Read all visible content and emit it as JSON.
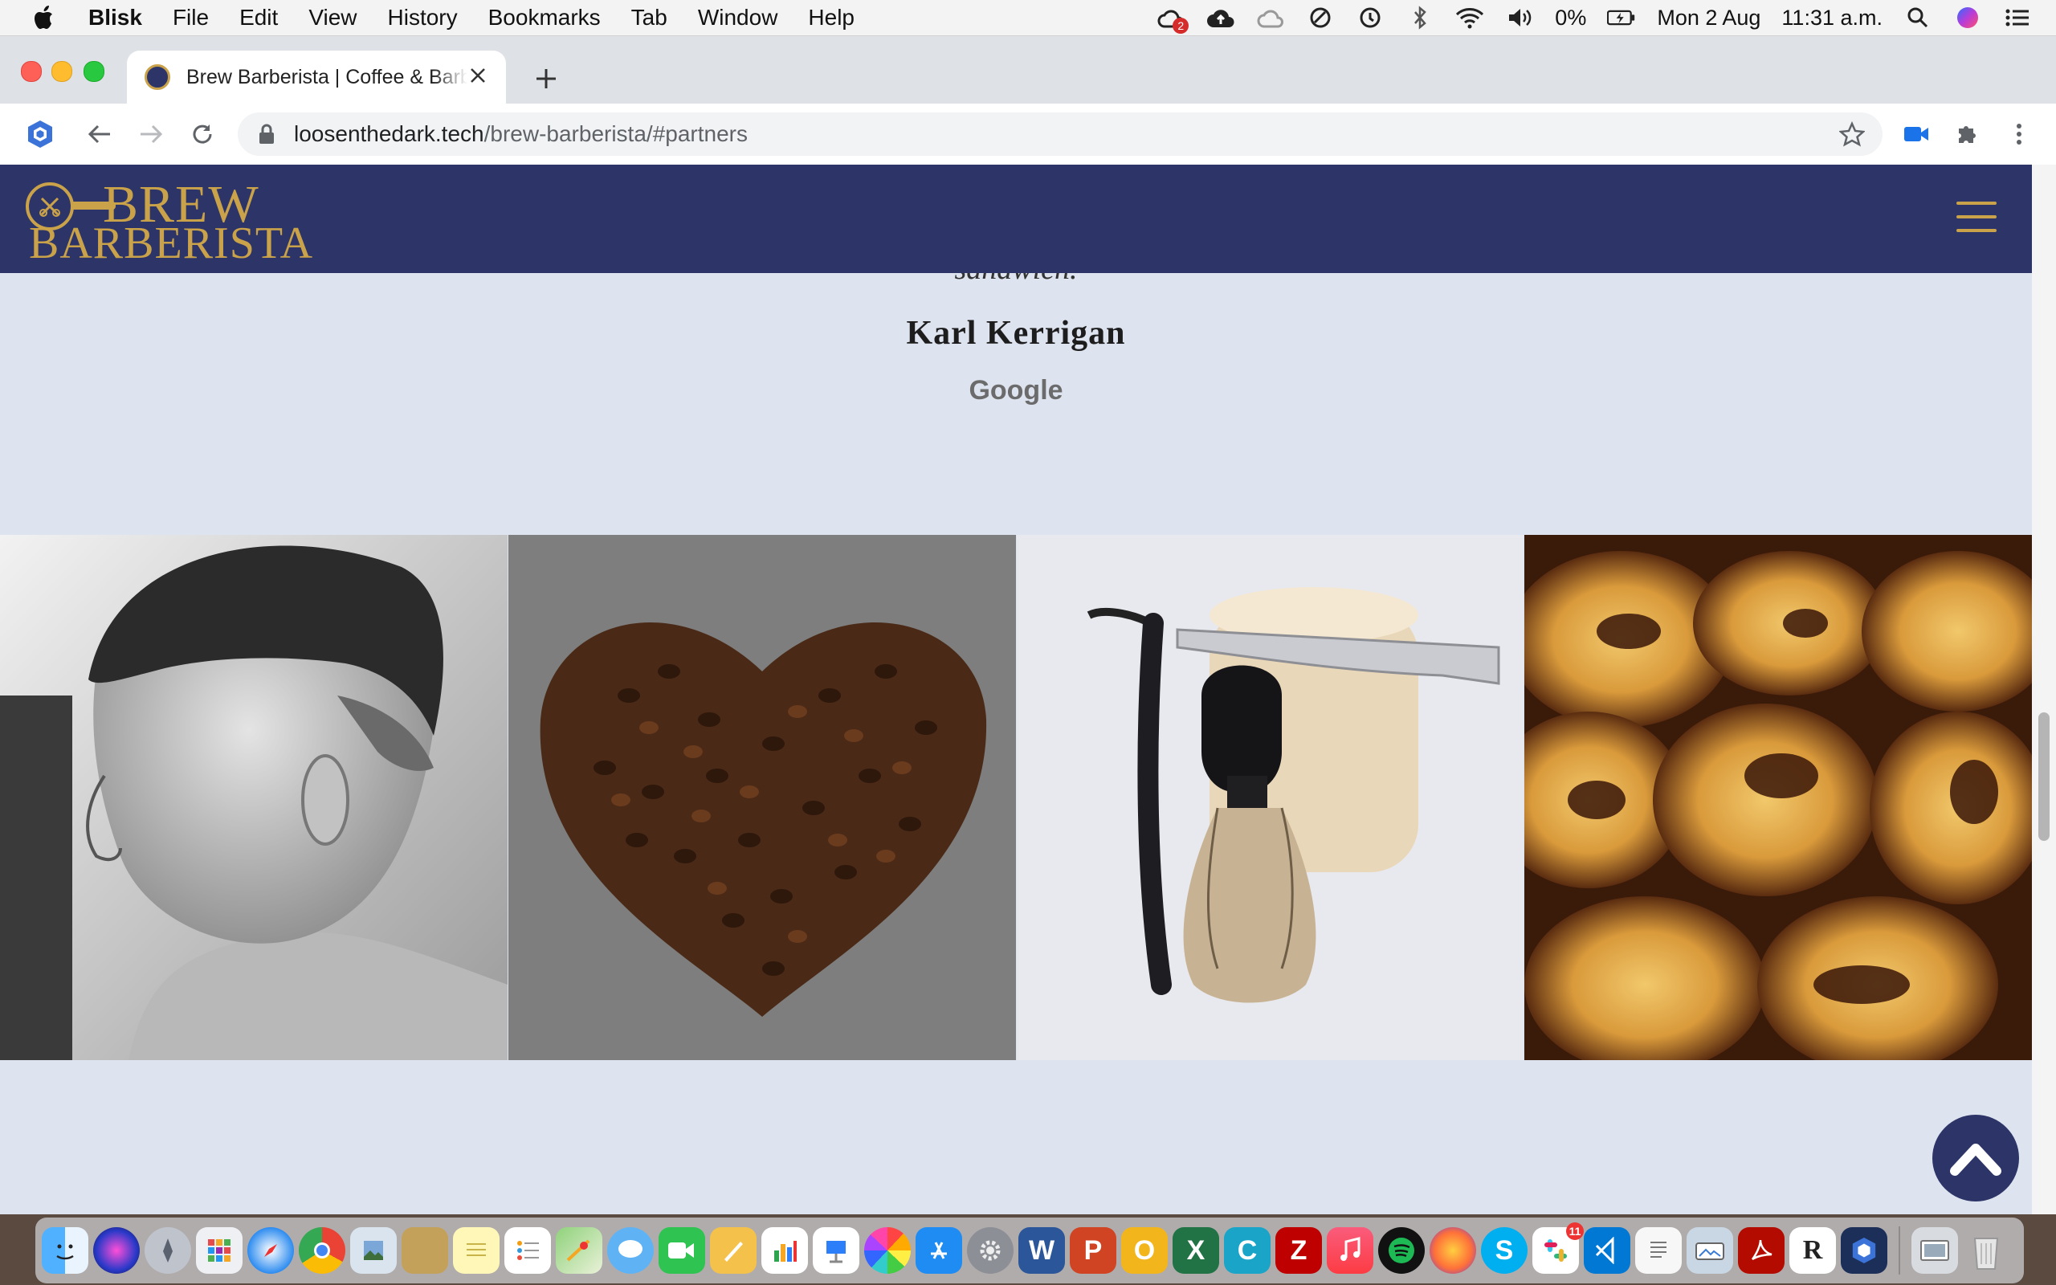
{
  "menubar": {
    "app_name": "Blisk",
    "items": [
      "File",
      "Edit",
      "View",
      "History",
      "Bookmarks",
      "Tab",
      "Window",
      "Help"
    ],
    "status": {
      "cloud_badge": "2",
      "battery": "0%",
      "date": "Mon 2 Aug",
      "time": "11:31 a.m."
    }
  },
  "browser": {
    "tab_title": "Brew Barberista | Coffee & Barber",
    "url_host": "loosenthedark.tech",
    "url_path": "/brew-barberista/#partners"
  },
  "site": {
    "logo_line1": "BREW",
    "logo_line2": "BARBERISTA",
    "brand_color": "#2d3568",
    "accent_color": "#c9a24a"
  },
  "testimonial": {
    "quote_tail": "sandwich.",
    "name": "Karl Kerrigan",
    "source": "Google"
  },
  "gallery": [
    {
      "name": "barber-haircut-photo",
      "subject": "fade haircut"
    },
    {
      "name": "coffee-beans-heart-photo",
      "subject": "coffee beans heart"
    },
    {
      "name": "razor-and-brush-photo",
      "subject": "straight razor and shaving brush"
    },
    {
      "name": "custard-tarts-photo",
      "subject": "pasteis de nata"
    }
  ],
  "dock": {
    "icons": [
      "finder-icon",
      "siri-icon",
      "launchpad-icon",
      "launchpad-grid-icon",
      "safari-icon",
      "chrome-icon",
      "preview-icon",
      "notes-yellow-icon",
      "notes-icon",
      "reminders-icon",
      "maps-icon",
      "messages-icon",
      "facetime-icon",
      "pages-icon",
      "numbers-icon",
      "keynote-icon",
      "photos-icon",
      "app-store-icon",
      "system-preferences-icon",
      "word-icon",
      "powerpoint-icon",
      "outlook-icon",
      "excel-icon",
      "cyberduck-icon",
      "filezilla-icon",
      "music-icon",
      "spotify-icon",
      "firefox-icon",
      "skype-icon",
      "slack-icon",
      "vscode-icon",
      "textedit-icon",
      "image-capture-icon",
      "acrobat-icon",
      "rr-icon",
      "blisk-icon",
      "downloads-icon",
      "trash-icon"
    ],
    "slack_badge": "11"
  }
}
